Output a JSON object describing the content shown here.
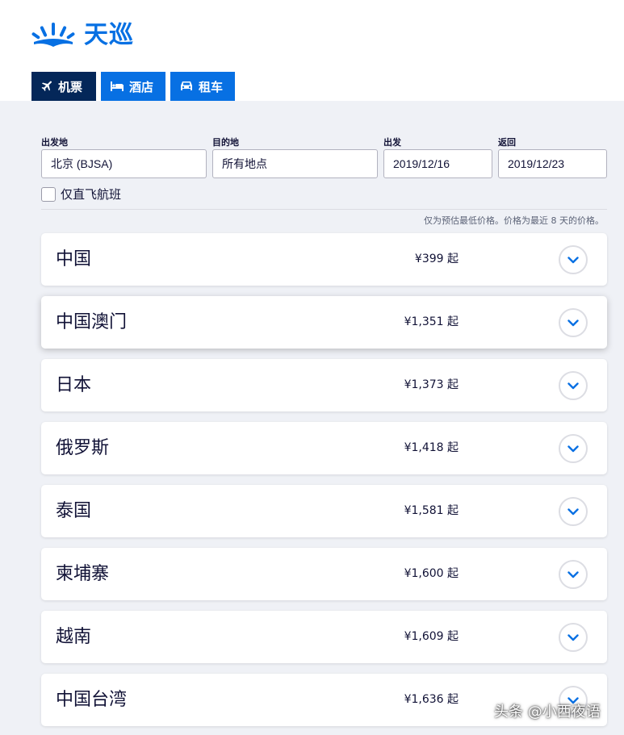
{
  "brand": {
    "name": "天巡",
    "color": "#0770e3"
  },
  "tabs": [
    {
      "label": "机票",
      "icon": "plane-icon",
      "active": true
    },
    {
      "label": "酒店",
      "icon": "bed-icon",
      "active": false
    },
    {
      "label": "租车",
      "icon": "car-icon",
      "active": false
    }
  ],
  "search": {
    "from_label": "出发地",
    "from_value": "北京 (BJSA)",
    "to_label": "目的地",
    "to_value": "所有地点",
    "depart_label": "出发",
    "depart_value": "2019/12/16",
    "return_label": "返回",
    "return_value": "2019/12/23",
    "direct_only_label": "仅直飞航班",
    "direct_only_checked": false
  },
  "price_note": "仅为预估最低价格。价格为最近 8 天的价格。",
  "results": [
    {
      "name": "中国",
      "price": "¥399 起"
    },
    {
      "name": "中国澳门",
      "price": "¥1,351 起"
    },
    {
      "name": "日本",
      "price": "¥1,373 起"
    },
    {
      "name": "俄罗斯",
      "price": "¥1,418 起"
    },
    {
      "name": "泰国",
      "price": "¥1,581 起"
    },
    {
      "name": "柬埔寨",
      "price": "¥1,600 起"
    },
    {
      "name": "越南",
      "price": "¥1,609 起"
    },
    {
      "name": "中国台湾",
      "price": "¥1,636 起"
    }
  ],
  "watermark": "头条 @小西夜语"
}
